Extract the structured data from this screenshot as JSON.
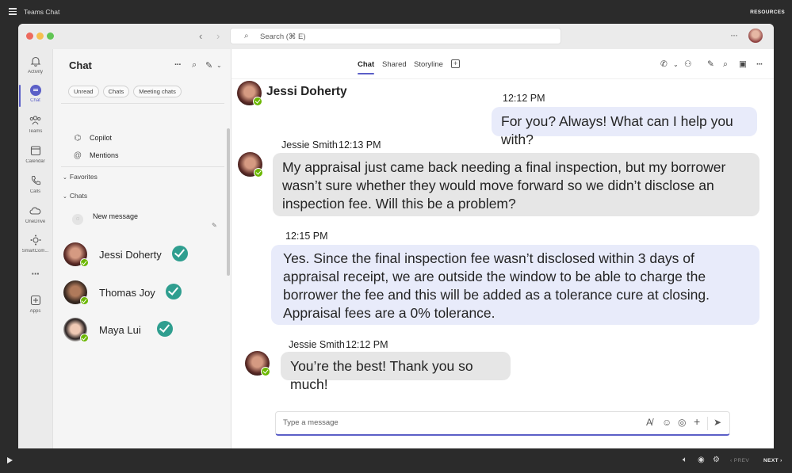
{
  "player": {
    "app_title": "Teams Chat",
    "resources_label": "RESOURCES",
    "prev_label": "PREV",
    "next_label": "NEXT"
  },
  "window": {
    "search_placeholder": "Search (⌘ E)"
  },
  "rail": {
    "items": [
      {
        "label": "Activity",
        "icon": "bell-icon"
      },
      {
        "label": "Chat",
        "icon": "chat-icon",
        "active": true
      },
      {
        "label": "Teams",
        "icon": "teams-icon"
      },
      {
        "label": "Calendar",
        "icon": "calendar-icon"
      },
      {
        "label": "Calls",
        "icon": "phone-icon"
      },
      {
        "label": "OneDrive",
        "icon": "cloud-icon"
      },
      {
        "label": "SmartCom...",
        "icon": "smartcomms-icon"
      },
      {
        "label": "Apps",
        "icon": "add-apps-icon"
      }
    ]
  },
  "list": {
    "title": "Chat",
    "filters": [
      "Unread",
      "Chats",
      "Meeting chats"
    ],
    "copilot_label": "Copilot",
    "mentions_label": "Mentions",
    "favorites_label": "Favorites",
    "chats_label": "Chats",
    "new_message_label": "New message",
    "contacts": [
      {
        "name": "Jessi Doherty"
      },
      {
        "name": "Thomas Joy"
      },
      {
        "name": "Maya Lui"
      }
    ]
  },
  "conversation": {
    "tabs": [
      "Chat",
      "Shared",
      "Storyline"
    ],
    "active_tab": "Chat",
    "peer_name": "Jessi Doherty",
    "messages": [
      {
        "from": "me",
        "time": "12:12 PM",
        "text": "For you? Always! What can I help you with?"
      },
      {
        "from": "them",
        "sender": "Jessie Smith",
        "time": "12:13 PM",
        "text": "My appraisal just came back needing a final inspection, but my borrower wasn’t sure whether they would move forward so we didn’t disclose an inspection fee. Will this be a problem?"
      },
      {
        "from": "me",
        "time": "12:15 PM",
        "text": "Yes. Since the final inspection fee wasn’t disclosed within 3 days of appraisal receipt, we are outside the window to be able to charge the borrower the fee and this will be added as a tolerance cure at closing. Appraisal fees are a 0% tolerance."
      },
      {
        "from": "them",
        "sender": "Jessie Smith",
        "time": "12:12 PM",
        "text": "You’re the best! Thank you so much!"
      }
    ],
    "composer_placeholder": "Type a message"
  },
  "colors": {
    "accent": "#5b5fc7",
    "my_bubble": "#e8ebfa",
    "their_bubble": "#e6e6e6",
    "presence": "#6bb700",
    "check": "#2f9e8f"
  }
}
